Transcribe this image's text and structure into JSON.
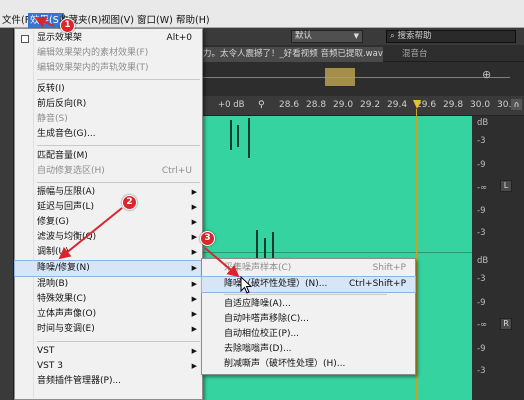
{
  "menubar": {
    "items": [
      "文件(F)",
      "效果(S)",
      "收藏夹(R)",
      "视图(V)",
      "窗口(W)",
      "帮助(H)"
    ]
  },
  "toolbar": {
    "workspace": "默认",
    "search_placeholder": "搜索帮助"
  },
  "editor": {
    "file_tab": "力。太令人震撼了！_好看视频 音频已提取.wav *",
    "mixer_tab": "混音台",
    "db_label": "+0 dB",
    "ruler_ticks": [
      "28.6",
      "28.8",
      "29.0",
      "29.2",
      "29.4",
      "29.6",
      "29.8",
      "30.0",
      "30.2"
    ],
    "scale_labels": [
      "dB",
      "-3",
      "-9",
      "-∞",
      "-9",
      "-3",
      "dB",
      "-3",
      "-9",
      "-∞",
      "-9",
      "-3"
    ],
    "channel_left": "L",
    "channel_right": "R"
  },
  "effects_menu": {
    "items": [
      {
        "label": "显示效果架",
        "shortcut": "Alt+0",
        "checked": true
      },
      {
        "label": "编辑效果架内的素材效果(F)",
        "disabled": true
      },
      {
        "label": "编辑效果架内的声轨效果(T)",
        "disabled": true
      },
      {
        "label": "反转(I)"
      },
      {
        "label": "前后反向(R)"
      },
      {
        "label": "静音(S)",
        "disabled": true
      },
      {
        "label": "生成音色(G)..."
      },
      {
        "label": "匹配音量(M)"
      },
      {
        "label": "自动修复选区(H)",
        "shortcut": "Ctrl+U",
        "disabled": true
      },
      {
        "label": "振幅与压限(A)",
        "submenu": true
      },
      {
        "label": "延迟与回声(L)",
        "submenu": true
      },
      {
        "label": "修复(G)",
        "submenu": true
      },
      {
        "label": "滤波与均衡(Q)",
        "submenu": true
      },
      {
        "label": "调制(U)",
        "submenu": true
      },
      {
        "label": "降噪/修复(N)",
        "submenu": true,
        "highlight": true
      },
      {
        "label": "混响(B)",
        "submenu": true
      },
      {
        "label": "特殊效果(C)",
        "submenu": true
      },
      {
        "label": "立体声声像(O)",
        "submenu": true
      },
      {
        "label": "时间与变调(E)",
        "submenu": true
      },
      {
        "label": "VST",
        "submenu": true
      },
      {
        "label": "VST 3",
        "submenu": true
      },
      {
        "label": "音频插件管理器(P)..."
      }
    ]
  },
  "submenu": {
    "items": [
      {
        "label": "采集噪声样本(C)",
        "shortcut": "Shift+P",
        "disabled": true
      },
      {
        "label": "降噪（破坏性处理）(N)...",
        "shortcut": "Ctrl+Shift+P",
        "highlight": true
      },
      {
        "label": "自适应降噪(A)..."
      },
      {
        "label": "自动咔嗒声移除(C)..."
      },
      {
        "label": "自动相位校正(P)..."
      },
      {
        "label": "去除嗡嗡声(D)..."
      },
      {
        "label": "削减嘶声（破坏性处理）(H)..."
      }
    ]
  },
  "annotations": {
    "badges": [
      "1",
      "2",
      "3"
    ],
    "color": "#d8262c"
  }
}
